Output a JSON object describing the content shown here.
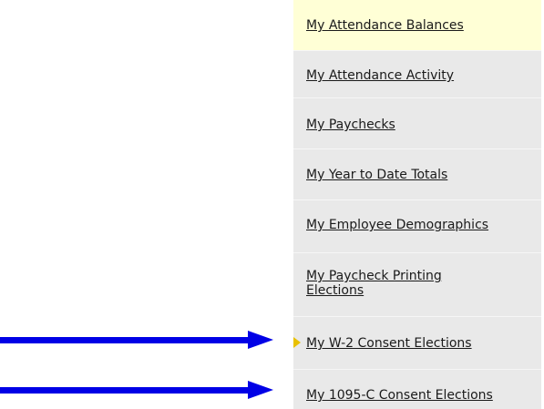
{
  "menu": {
    "items": [
      {
        "label": "My Attendance Balances"
      },
      {
        "label": "My Attendance Activity"
      },
      {
        "label": "My Paychecks"
      },
      {
        "label": "My Year to Date Totals"
      },
      {
        "label": "My Employee Demographics"
      },
      {
        "label": "My Paycheck Printing Elections"
      },
      {
        "label": "My W-2 Consent Elections"
      },
      {
        "label": "My 1095-C Consent Elections"
      }
    ]
  },
  "annotations": {
    "arrow_color": "#0000e6",
    "active_item_color": "#ffffd6",
    "caret_color": "#e8c000",
    "menu_bg_color": "#e9e9e9"
  }
}
